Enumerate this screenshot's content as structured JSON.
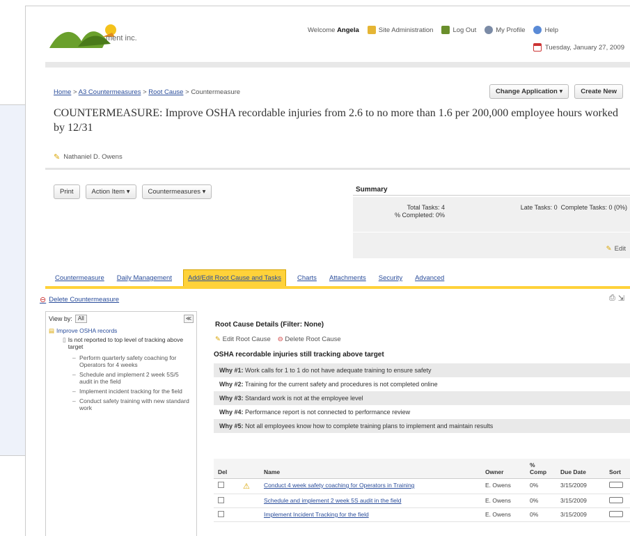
{
  "header": {
    "logo_text": "ment inc.",
    "welcome_prefix": "Welcome",
    "welcome_name": "Angela",
    "links": [
      "Site Administration",
      "Log Out",
      "My Profile",
      "Help"
    ],
    "date": "Tuesday, January 27, 2009"
  },
  "breadcrumb": {
    "items": [
      "Home",
      "A3 Countermeasures",
      "Root Cause",
      "Countermeasure"
    ],
    "separator": ">"
  },
  "top_buttons": {
    "change_app": "Change Application",
    "create_new": "Create New"
  },
  "title": "COUNTERMEASURE: Improve OSHA recordable injuries from 2.6 to no more than 1.6 per 200,000 employee hours worked by 12/31",
  "author": "Nathaniel D. Owens",
  "actions": [
    "Print",
    "Action Item",
    "Countermeasures"
  ],
  "summary": {
    "title": "Summary",
    "total_tasks": "Total Tasks: 4",
    "tasks_pct": "% Completed: 0%",
    "late_tasks": "Late Tasks: 0",
    "complete_tasks": "Complete Tasks: 0 (0%)",
    "edit_label": "Edit"
  },
  "tabs": [
    "Countermeasure",
    "Daily Management",
    "Add/Edit Root Cause and Tasks",
    "Charts",
    "Attachments",
    "Security",
    "Advanced"
  ],
  "active_tab": 2,
  "delete_link": "Delete Countermeasure",
  "tree": {
    "view_label": "View by:",
    "view_value": "All",
    "root": "Improve OSHA records",
    "sub": "Is not reported to top level of tracking above target",
    "children": [
      "Perform quarterly safety coaching for Operators for 4 weeks",
      "Schedule and implement 2 week 5S/5 audit in the field",
      "Implement incident tracking for the field",
      "Conduct safety training with new standard work"
    ]
  },
  "root_cause": {
    "title": "Root Cause Details (Filter: None)",
    "edit_label": "Edit Root Cause",
    "delete_label": "Delete Root Cause",
    "subtitle": "OSHA recordable injuries still tracking above target",
    "whys": [
      {
        "label": "Why #1:",
        "text": "Work calls for 1 to 1 do not have adequate training to ensure safety"
      },
      {
        "label": "Why #2:",
        "text": "Training for the current safety and procedures is not completed online"
      },
      {
        "label": "Why #3:",
        "text": "Standard work is not at the employee level"
      },
      {
        "label": "Why #4:",
        "text": "Performance report is not connected to performance review"
      },
      {
        "label": "Why #5:",
        "text": "Not all employees know how to complete training plans to implement and maintain results"
      }
    ]
  },
  "tasks_table": {
    "headers": [
      "Del",
      "",
      "Name",
      "Owner",
      "% Comp",
      "Due Date",
      "Sort"
    ],
    "rows": [
      {
        "name": "Conduct 4 week safety coaching for Operators in Training",
        "owner": "E. Owens",
        "comp": "0%",
        "due": "3/15/2009"
      },
      {
        "name": "Schedule and implement 2 week 5S audit in the field",
        "owner": "E. Owens",
        "comp": "0%",
        "due": "3/15/2009"
      },
      {
        "name": "Implement Incident Tracking for the field",
        "owner": "E. Owens",
        "comp": "0%",
        "due": "3/15/2009"
      }
    ]
  },
  "colors": {
    "accent": "#ffd23a",
    "link": "#2a4d9b",
    "panel": "#f0f0f0"
  }
}
